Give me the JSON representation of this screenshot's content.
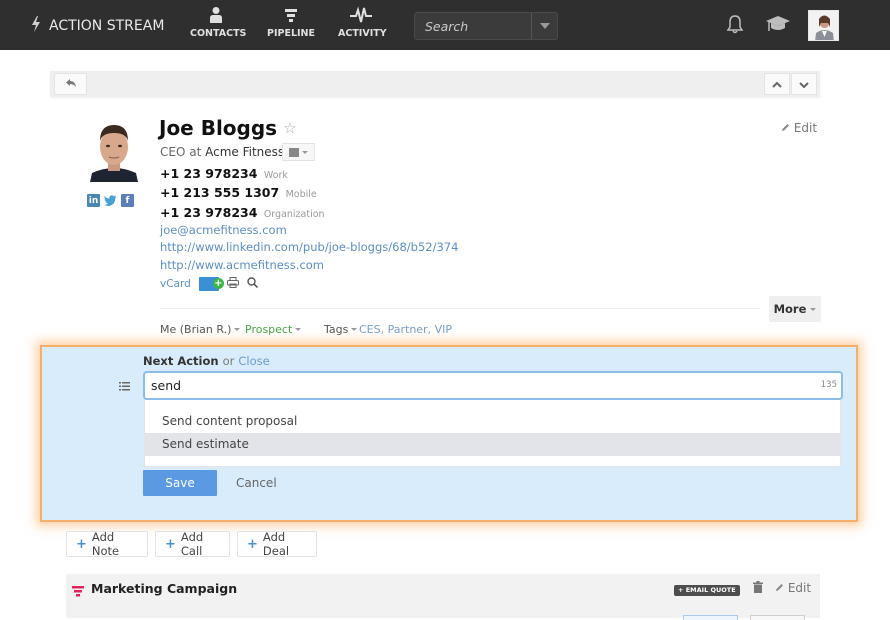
{
  "topbar": {
    "brand": "ACTION STREAM",
    "nav": [
      {
        "label": "CONTACTS",
        "icon": "person-icon"
      },
      {
        "label": "PIPELINE",
        "icon": "funnel-icon"
      },
      {
        "label": "ACTIVITY",
        "icon": "pulse-icon"
      }
    ],
    "search_placeholder": "Search"
  },
  "toolbar": {
    "back_icon": "↰",
    "up_icon": "⌃",
    "down_icon": "⌄"
  },
  "contact": {
    "name": "Joe Bloggs",
    "star": "☆",
    "title_prefix": "CEO at",
    "company": "Acme Fitness",
    "edit_label": "Edit",
    "phones": [
      {
        "number": "+1 23 978234",
        "type": "Work"
      },
      {
        "number": "+1 213 555 1307",
        "type": "Mobile"
      },
      {
        "number": "+1 23 978234",
        "type": "Organization"
      }
    ],
    "email": "joe@acmefitness.com",
    "linkedin_url": "http://www.linkedin.com/pub/joe-bloggs/68/b52/374",
    "website": "http://www.acmefitness.com",
    "vcard_label": "vCard",
    "social": [
      "in",
      "t",
      "f"
    ],
    "more_label": "More",
    "owner": "Me (Brian R.)",
    "status": "Prospect",
    "tags_label": "Tags",
    "tags": "CES, Partner, VIP"
  },
  "next_action": {
    "label": "Next Action",
    "or": "or",
    "close": "Close",
    "value": "send",
    "char_count": "135",
    "suggestions": [
      "Send content proposal",
      "Send estimate"
    ],
    "save_label": "Save",
    "cancel_label": "Cancel"
  },
  "add_buttons": [
    "Add Note",
    "Add Call",
    "Add Deal"
  ],
  "campaign": {
    "title": "Marketing Campaign",
    "email_quote": "+ EMAIL QUOTE",
    "edit_label": "Edit"
  },
  "colors": {
    "topbar": "#2f2f2f",
    "accent_blue": "#5b9ae2",
    "panel_bg": "#d9ecfb",
    "panel_glow": "#f6ae6c",
    "status_green": "#4aa84a",
    "campaign_icon": "#e0245e"
  }
}
